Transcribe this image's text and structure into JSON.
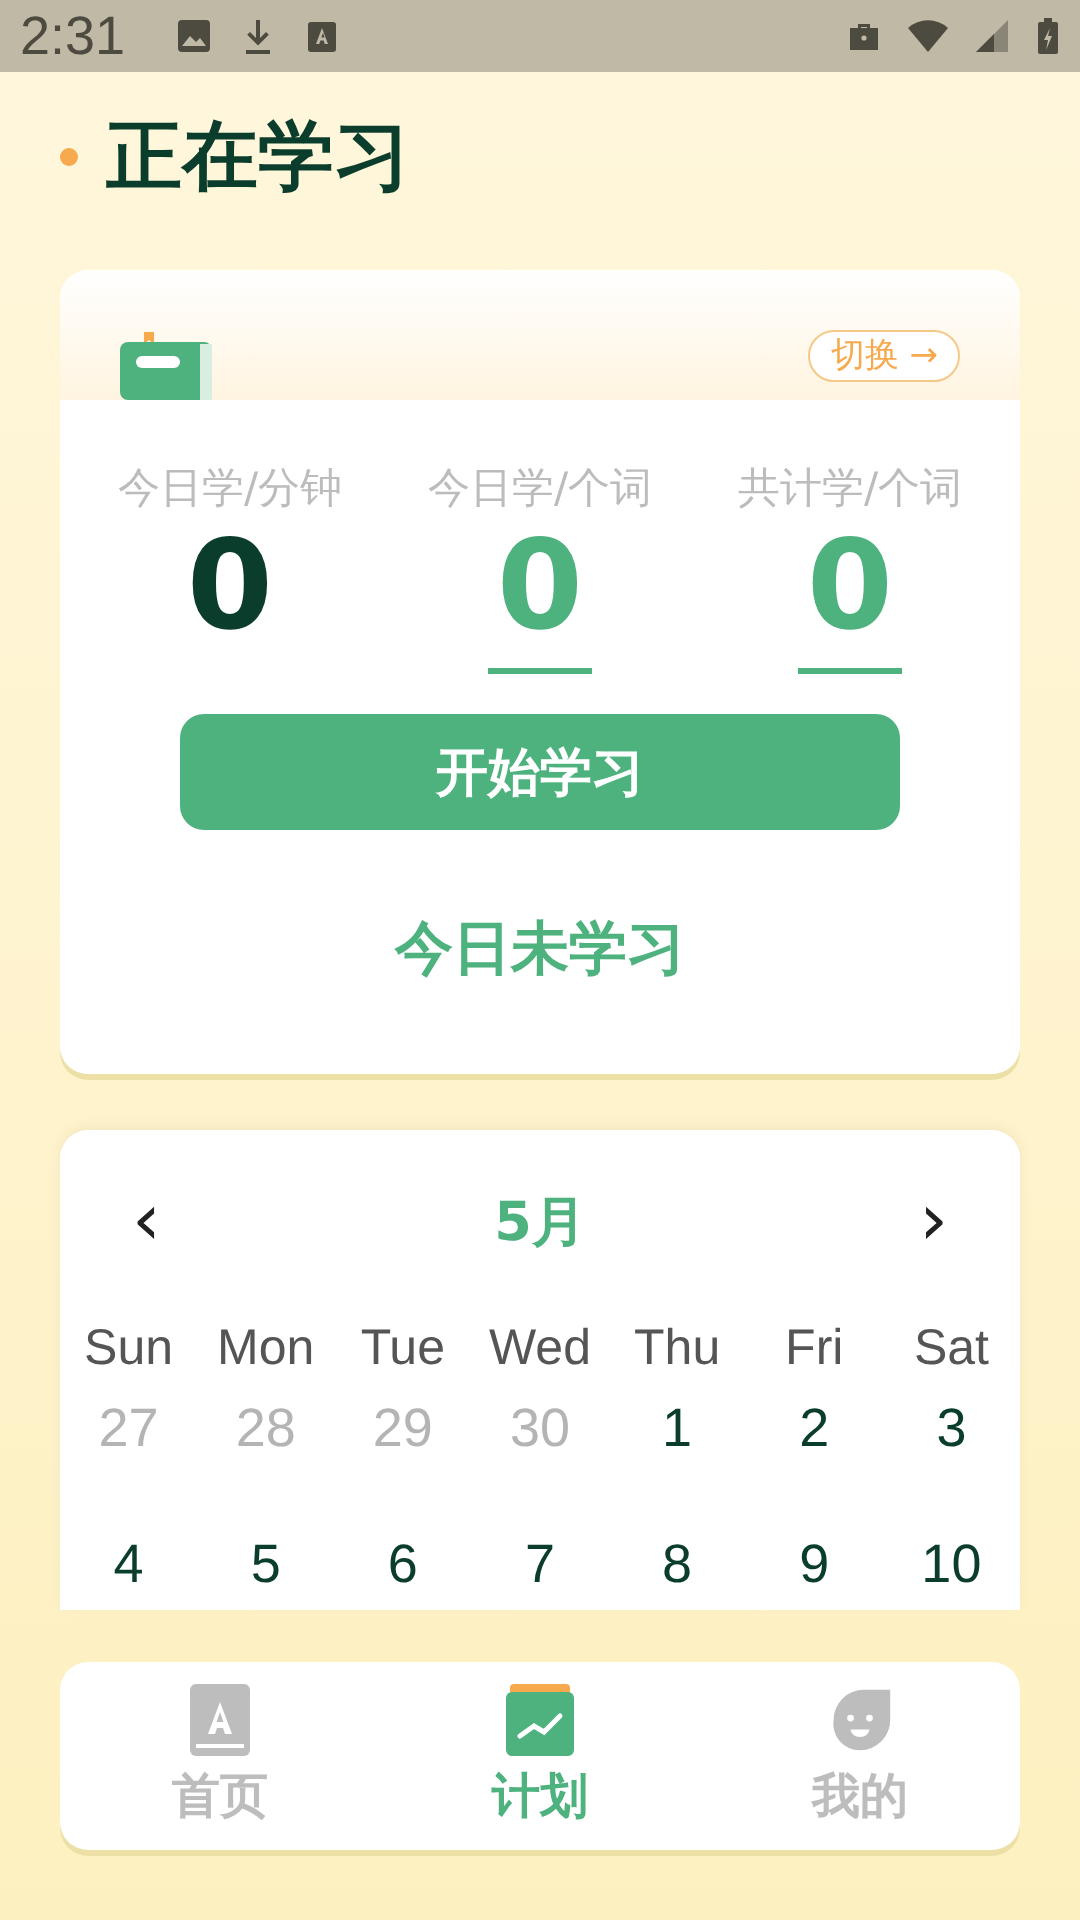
{
  "status_bar": {
    "time": "2:31"
  },
  "title": "正在学习",
  "study_card": {
    "switch_label": "切换 →",
    "stats": [
      {
        "label": "今日学/分钟",
        "value": "0",
        "highlighted": false
      },
      {
        "label": "今日学/个词",
        "value": "0",
        "highlighted": true
      },
      {
        "label": "共计学/个词",
        "value": "0",
        "highlighted": true
      }
    ],
    "start_button": "开始学习",
    "status_text": "今日未学习"
  },
  "calendar": {
    "month": "5月",
    "prev": "‹",
    "next": "›",
    "weekdays": [
      "Sun",
      "Mon",
      "Tue",
      "Wed",
      "Thu",
      "Fri",
      "Sat"
    ],
    "days": [
      {
        "label": "27",
        "other_month": true
      },
      {
        "label": "28",
        "other_month": true
      },
      {
        "label": "29",
        "other_month": true
      },
      {
        "label": "30",
        "other_month": true
      },
      {
        "label": "1",
        "other_month": false
      },
      {
        "label": "2",
        "other_month": false
      },
      {
        "label": "3",
        "other_month": false
      },
      {
        "label": "4",
        "other_month": false
      },
      {
        "label": "5",
        "other_month": false
      },
      {
        "label": "6",
        "other_month": false
      },
      {
        "label": "7",
        "other_month": false
      },
      {
        "label": "8",
        "other_month": false
      },
      {
        "label": "9",
        "other_month": false
      },
      {
        "label": "10",
        "other_month": false
      }
    ]
  },
  "tabs": [
    {
      "label": "首页",
      "kind": "home",
      "selected": false
    },
    {
      "label": "计划",
      "kind": "plan",
      "selected": true
    },
    {
      "label": "我的",
      "kind": "me",
      "selected": false
    }
  ]
}
